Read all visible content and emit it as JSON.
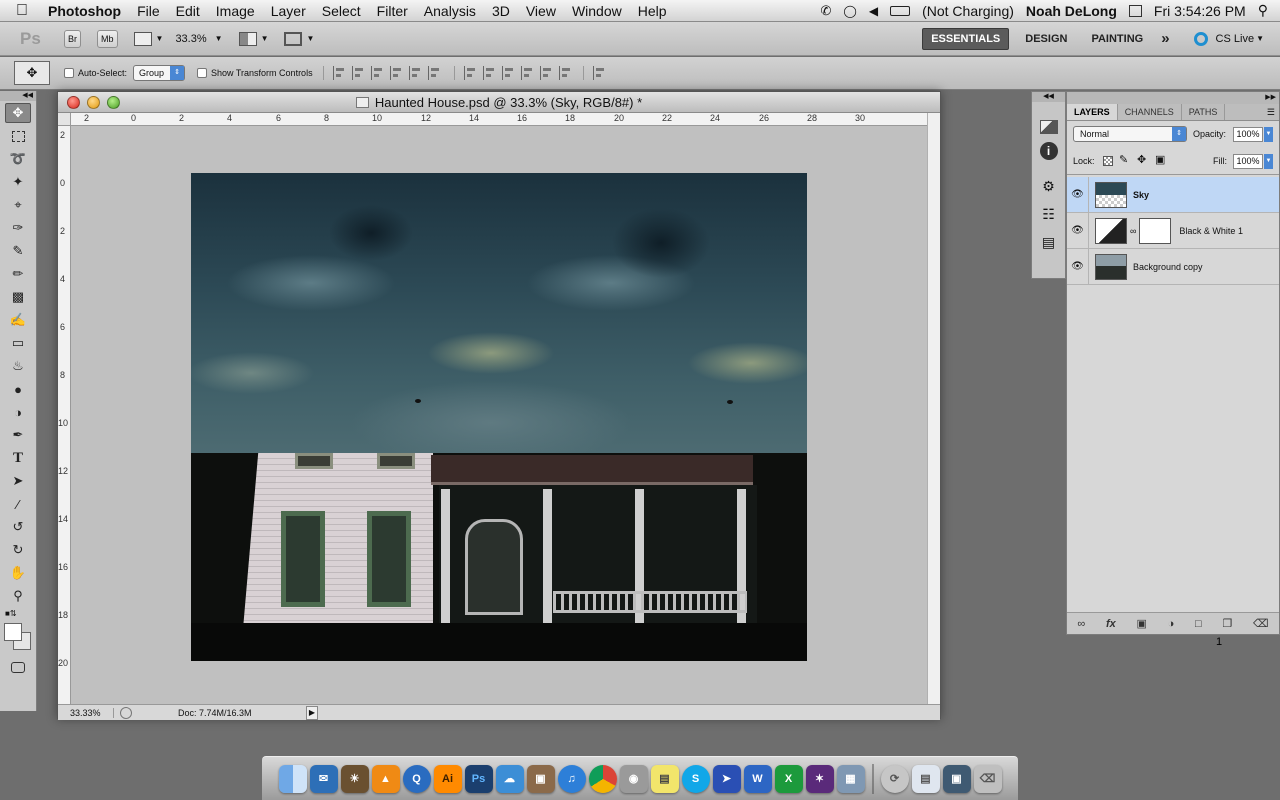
{
  "menubar": {
    "apple": "",
    "app_name": "Photoshop",
    "items": [
      "File",
      "Edit",
      "Image",
      "Layer",
      "Select",
      "Filter",
      "Analysis",
      "3D",
      "View",
      "Window",
      "Help"
    ],
    "battery": "(Not Charging)",
    "user": "Noah DeLong",
    "clock": "Fri 3:54:26 PM"
  },
  "appbar": {
    "ps_logo": "Ps",
    "br": "Br",
    "mb": "Mb",
    "zoom": "33.3%",
    "workspaces": [
      "ESSENTIALS",
      "DESIGN",
      "PAINTING"
    ],
    "active_workspace": "ESSENTIALS",
    "more": "»",
    "cs_live": "CS Live"
  },
  "options": {
    "auto_select_label": "Auto-Select:",
    "auto_select_value": "Group",
    "show_transform_label": "Show Transform Controls"
  },
  "document": {
    "title": "Haunted House.psd @ 33.3% (Sky, RGB/8#) *",
    "status_zoom": "33.33%",
    "doc_size": "Doc: 7.74M/16.3M",
    "ruler_h": [
      "2",
      "0",
      "2",
      "4",
      "6",
      "8",
      "10",
      "12",
      "14",
      "16",
      "18",
      "20",
      "22",
      "24",
      "26",
      "28",
      "30"
    ],
    "ruler_v": [
      "2",
      "0",
      "2",
      "4",
      "6",
      "8",
      "10",
      "12",
      "14",
      "16",
      "18",
      "20"
    ]
  },
  "layers_panel": {
    "tabs": [
      "LAYERS",
      "CHANNELS",
      "PATHS"
    ],
    "blend_mode": "Normal",
    "opacity_label": "Opacity:",
    "opacity": "100%",
    "lock_label": "Lock:",
    "fill_label": "Fill:",
    "fill": "100%",
    "layers": [
      {
        "name": "Sky",
        "selected": true
      },
      {
        "name": "Black & White 1",
        "selected": false
      },
      {
        "name": "Background copy",
        "selected": false
      }
    ],
    "footer_count": "1"
  },
  "colors": {
    "accent_selected_layer": "#bfd7f5",
    "menubar": "#e6e6e6",
    "workspace_active": "#5b5b5b"
  }
}
